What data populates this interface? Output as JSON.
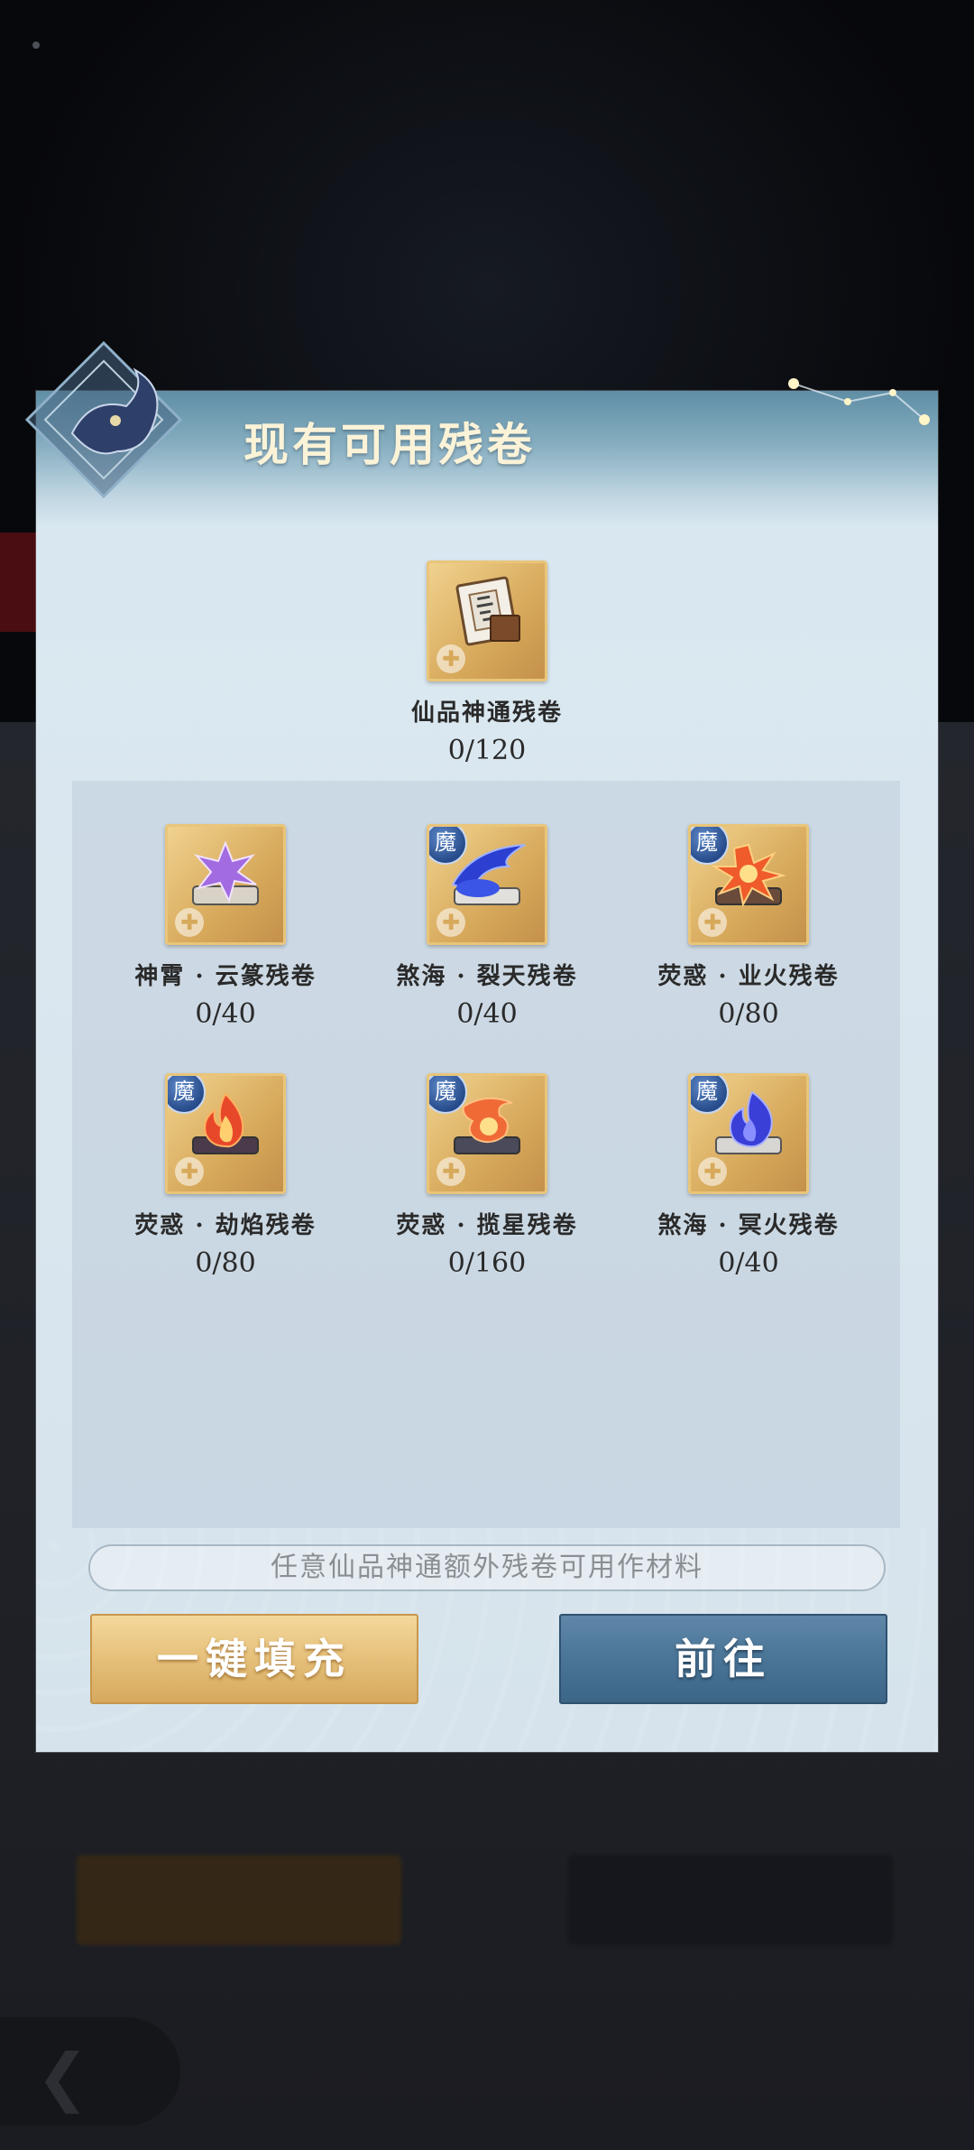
{
  "dialog": {
    "title": "现有可用残卷",
    "featured": {
      "name": "仙品神通残卷",
      "count": "0/120",
      "icon": "scroll-book-icon"
    },
    "items": [
      {
        "name": "神霄 · 云篆残卷",
        "count": "0/40",
        "badge": "",
        "icon": "purple-lightning-scroll-icon",
        "color": "#a26be0"
      },
      {
        "name": "煞海 · 裂天残卷",
        "count": "0/40",
        "badge": "魔",
        "icon": "blue-wave-scroll-icon",
        "color": "#2b3fd1"
      },
      {
        "name": "荧惑 · 业火残卷",
        "count": "0/80",
        "badge": "魔",
        "icon": "fire-burst-scroll-icon",
        "color": "#ef5b2a"
      },
      {
        "name": "荧惑 · 劫焰残卷",
        "count": "0/80",
        "badge": "魔",
        "icon": "flame-scroll-icon",
        "color": "#e8482a"
      },
      {
        "name": "荧惑 · 揽星残卷",
        "count": "0/160",
        "badge": "魔",
        "icon": "star-flame-scroll-icon",
        "color": "#f06a36"
      },
      {
        "name": "煞海 · 冥火残卷",
        "count": "0/40",
        "badge": "魔",
        "icon": "blue-flame-scroll-icon",
        "color": "#3a3fd8"
      }
    ],
    "hint": "任意仙品神通额外残卷可用作材料",
    "fill_button": "一键填充",
    "go_button": "前往"
  }
}
